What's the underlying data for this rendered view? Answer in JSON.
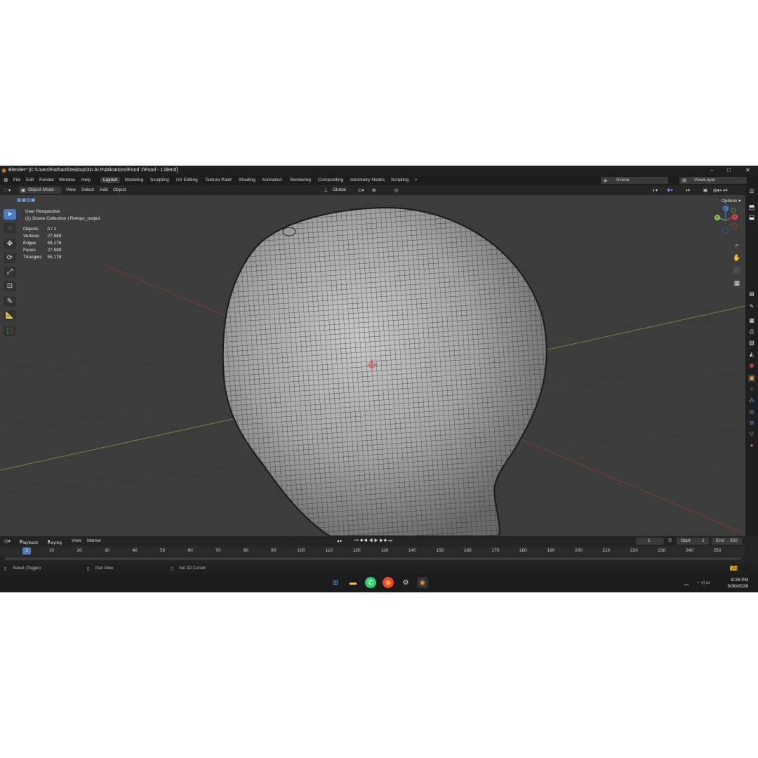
{
  "window": {
    "title": "Blender* [C:\\Users\\Farhan\\Desktop\\3D AI Publications\\Food 1\\Food - 1.blend]",
    "minimize": "–",
    "maximize": "□",
    "close": "✕"
  },
  "menu": {
    "items": [
      "File",
      "Edit",
      "Render",
      "Window",
      "Help"
    ],
    "workspaces": [
      "Layout",
      "Modeling",
      "Sculpting",
      "UV Editing",
      "Texture Paint",
      "Shading",
      "Animation",
      "Rendering",
      "Compositing",
      "Geometry Nodes",
      "Scripting"
    ],
    "active_workspace": "Layout",
    "add_tab": "+",
    "scene": "Scene",
    "view_layer": "ViewLayer"
  },
  "header": {
    "mode": "Object Mode",
    "items": [
      "View",
      "Select",
      "Add",
      "Object"
    ],
    "orientation": "Global",
    "options": "Options"
  },
  "viewport": {
    "perspective": "User Perspective",
    "collection": "(1) Scene Collection | Retopo_output",
    "stats": [
      {
        "label": "Objects",
        "value": "0 / 1"
      },
      {
        "label": "Vertices",
        "value": "27,589"
      },
      {
        "label": "Edges",
        "value": "55,178"
      },
      {
        "label": "Faces",
        "value": "27,589"
      },
      {
        "label": "Triangles",
        "value": "55,178"
      }
    ],
    "gizmo": {
      "x": "X",
      "y": "Y",
      "z": "Z"
    }
  },
  "timeline": {
    "items": [
      "Playback",
      "Keying",
      "View",
      "Marker"
    ],
    "current_frame": "1",
    "start_label": "Start",
    "start": "1",
    "end_label": "End",
    "end": "250",
    "ticks": [
      "1",
      "10",
      "20",
      "30",
      "40",
      "50",
      "60",
      "70",
      "80",
      "90",
      "100",
      "110",
      "120",
      "130",
      "140",
      "150",
      "160",
      "170",
      "180",
      "190",
      "200",
      "210",
      "220",
      "230",
      "240",
      "250"
    ]
  },
  "status": {
    "hint1": "Select (Toggle)",
    "hint2": "Pan View",
    "hint3": "Set 3D Cursor",
    "version": "3.6.9"
  },
  "taskbar": {
    "time": "8:26 PM",
    "date": "6/30/2026",
    "apps": [
      "windows-start",
      "file-explorer",
      "whatsapp",
      "chrome",
      "steam",
      "blender"
    ]
  },
  "colors": {
    "accent": "#4a7cc0",
    "x_axis": "#e0484e",
    "y_axis": "#8bc34a",
    "z_axis": "#3f7fd8",
    "warning": "#c9a227"
  }
}
